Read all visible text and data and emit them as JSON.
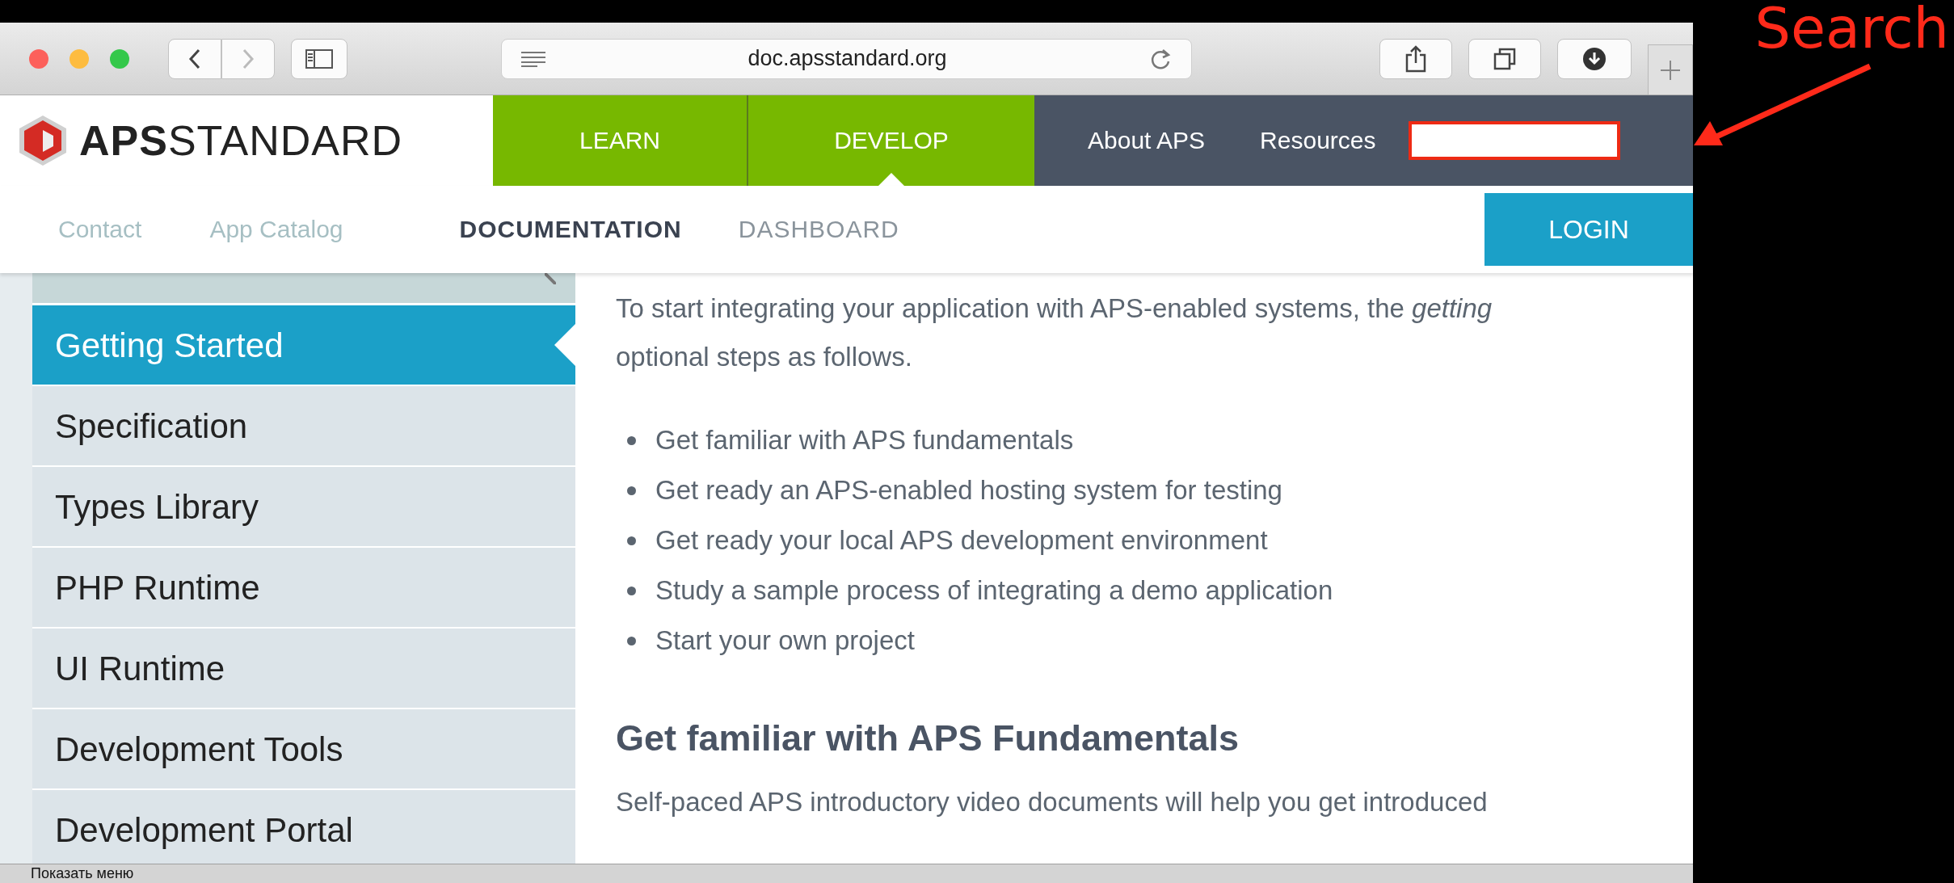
{
  "browser": {
    "address": "doc.apsstandard.org"
  },
  "header": {
    "logo": "**APS**STANDARD",
    "nav": [
      {
        "label": "LEARN",
        "kind": "primary",
        "selected": false
      },
      {
        "label": "DEVELOP",
        "kind": "primary",
        "selected": true
      },
      {
        "label": "About APS",
        "kind": "secondary",
        "selected": false
      },
      {
        "label": "Resources",
        "kind": "secondary",
        "selected": false
      }
    ]
  },
  "subnav": {
    "links": [
      {
        "label": "Contact"
      },
      {
        "label": "App Catalog"
      }
    ],
    "tabs": [
      {
        "label": "DOCUMENTATION",
        "selected": true
      },
      {
        "label": "DASHBOARD",
        "selected": false
      }
    ],
    "login": "LOGIN"
  },
  "sidebar": {
    "items": [
      {
        "label": "Getting Started",
        "selected": true
      },
      {
        "label": "Specification",
        "selected": false
      },
      {
        "label": "Types Library",
        "selected": false
      },
      {
        "label": "PHP Runtime",
        "selected": false
      },
      {
        "label": "UI Runtime",
        "selected": false
      },
      {
        "label": "Development Tools",
        "selected": false
      },
      {
        "label": "Development Portal",
        "selected": false
      }
    ]
  },
  "content": {
    "intro_lines": [
      "To start integrating your application with APS-enabled systems, the *getting*",
      "optional steps as follows."
    ],
    "bullets": [
      "Get familiar with APS fundamentals",
      "Get ready an APS-enabled hosting system for testing",
      "Get ready your local APS development environment",
      "Study a sample process of integrating a demo application",
      "Start your own project"
    ],
    "heading": "Get familiar with APS Fundamentals",
    "paragraph": "Self-paced APS introductory video documents will help you get introduced"
  },
  "status_bar": "Показать меню",
  "annotation": {
    "label": "Search"
  }
}
